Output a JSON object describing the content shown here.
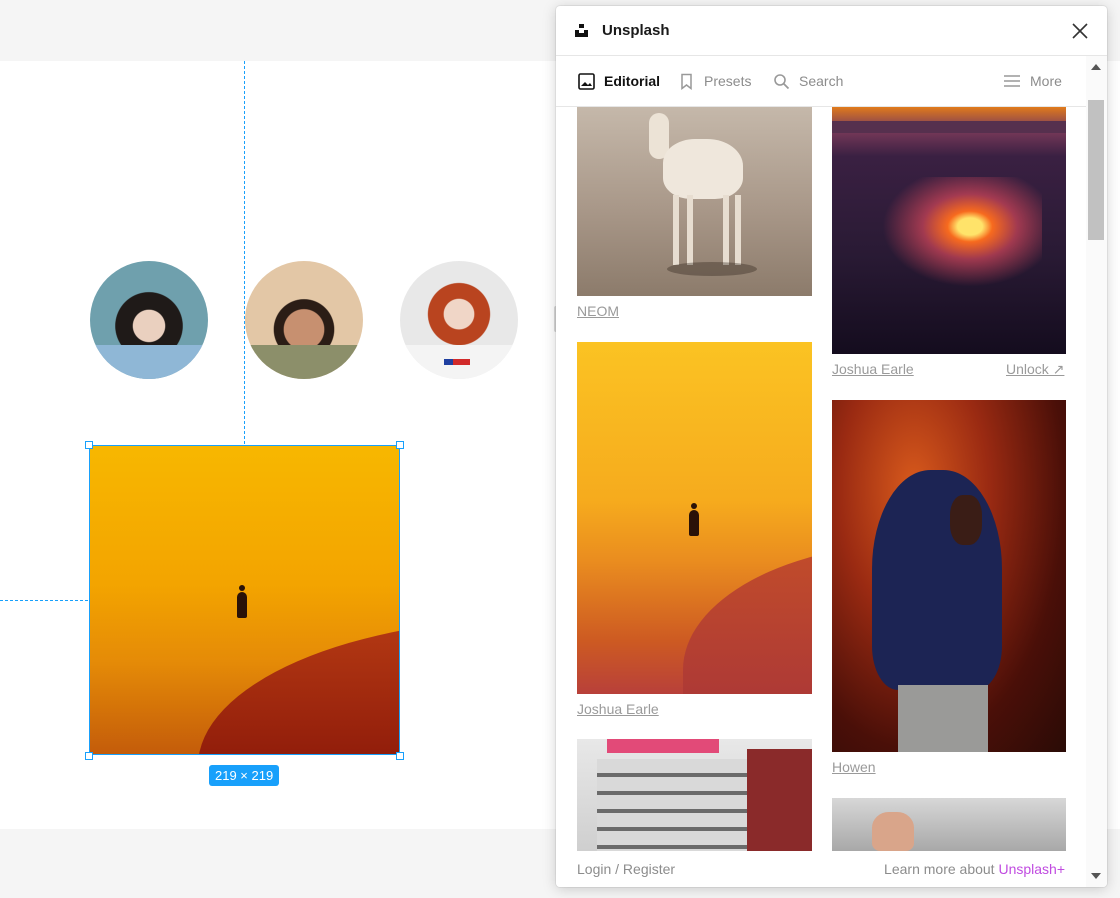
{
  "canvas": {
    "selection_size_label": "219 × 219",
    "avatars": [
      "woman-with-dark-hair",
      "man-with-dark-hair",
      "woman-with-red-hair"
    ],
    "accent_color": "#18a0fb"
  },
  "plugin": {
    "title": "Unsplash",
    "tabs": [
      {
        "label": "Editorial",
        "icon": "image-icon",
        "active": true
      },
      {
        "label": "Presets",
        "icon": "bookmark-icon",
        "active": false
      },
      {
        "label": "Search",
        "icon": "search-icon",
        "active": false
      }
    ],
    "more_label": "More",
    "photos": {
      "col1": [
        {
          "credit": "NEOM",
          "subject": "gazelle"
        },
        {
          "credit": "Joshua Earle",
          "subject": "person-walking-on-desert"
        },
        {
          "credit": "",
          "subject": "city-building"
        }
      ],
      "col2": [
        {
          "credit": "Joshua Earle",
          "unlock_label": "Unlock ↗",
          "subject": "volcano"
        },
        {
          "credit": "Howen",
          "subject": "person-in-hooded-jacket"
        },
        {
          "credit": "",
          "subject": "hand"
        }
      ]
    },
    "footer": {
      "login_label": "Login / Register",
      "learn_more_prefix": "Learn more about ",
      "unsplash_plus_label": "Unsplash+",
      "unsplash_plus_color": "#c04be0"
    }
  }
}
